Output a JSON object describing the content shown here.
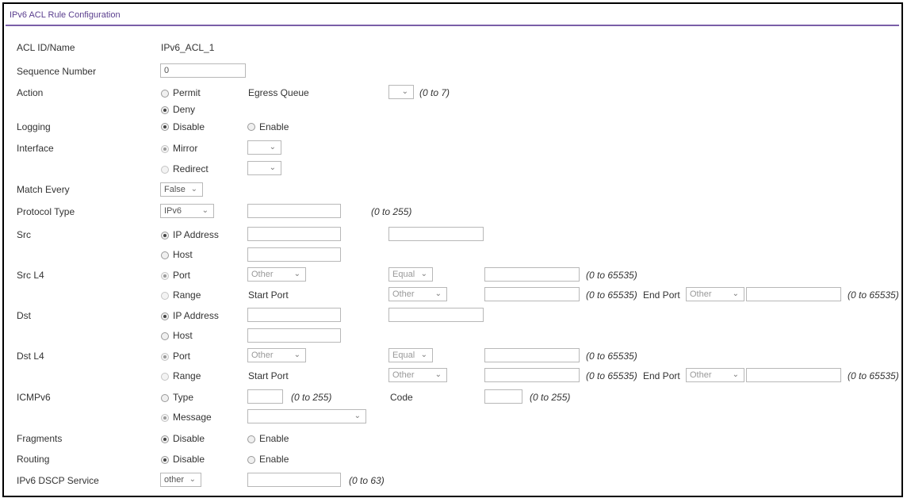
{
  "title": "IPv6 ACL Rule Configuration",
  "labels": {
    "acl_id": "ACL ID/Name",
    "sequence": "Sequence Number",
    "action": "Action",
    "logging": "Logging",
    "interface": "Interface",
    "match_every": "Match Every",
    "protocol_type": "Protocol Type",
    "src": "Src",
    "src_l4": "Src L4",
    "dst": "Dst",
    "dst_l4": "Dst L4",
    "icmpv6": "ICMPv6",
    "fragments": "Fragments",
    "routing": "Routing",
    "dscp": "IPv6 DSCP Service"
  },
  "acl_id_value": "IPv6_ACL_1",
  "sequence_value": "0",
  "action": {
    "permit": "Permit",
    "deny": "Deny",
    "egress_label": "Egress Queue",
    "egress_value": "",
    "egress_range": "(0 to 7)"
  },
  "logging": {
    "disable": "Disable",
    "enable": "Enable"
  },
  "interface": {
    "mirror": "Mirror",
    "redirect": "Redirect"
  },
  "match_every_value": "False",
  "protocol": {
    "value": "IPv6",
    "number": "",
    "range": "(0 to 255)"
  },
  "src": {
    "ip": "IP Address",
    "host": "Host"
  },
  "src_l4": {
    "port": "Port",
    "range": "Range",
    "start_port": "Start Port",
    "end_port": "End Port",
    "port_value": "Other",
    "op_value": "Equal",
    "start_value": "Other",
    "end_value": "Other",
    "port_range": "(0 to 65535)",
    "start_range": "(0 to 65535)",
    "end_range": "(0 to 65535)"
  },
  "dst": {
    "ip": "IP Address",
    "host": "Host"
  },
  "dst_l4": {
    "port": "Port",
    "range": "Range",
    "start_port": "Start Port",
    "end_port": "End Port",
    "port_value": "Other",
    "op_value": "Equal",
    "start_value": "Other",
    "end_value": "Other",
    "port_range": "(0 to 65535)",
    "start_range": "(0 to 65535)",
    "end_range": "(0 to 65535)"
  },
  "icmp": {
    "type": "Type",
    "type_range": "(0 to 255)",
    "code": "Code",
    "code_range": "(0 to 255)",
    "message": "Message",
    "message_value": ""
  },
  "fragments": {
    "disable": "Disable",
    "enable": "Enable"
  },
  "routing": {
    "disable": "Disable",
    "enable": "Enable"
  },
  "dscp": {
    "value": "other",
    "range": "(0 to 63)"
  }
}
